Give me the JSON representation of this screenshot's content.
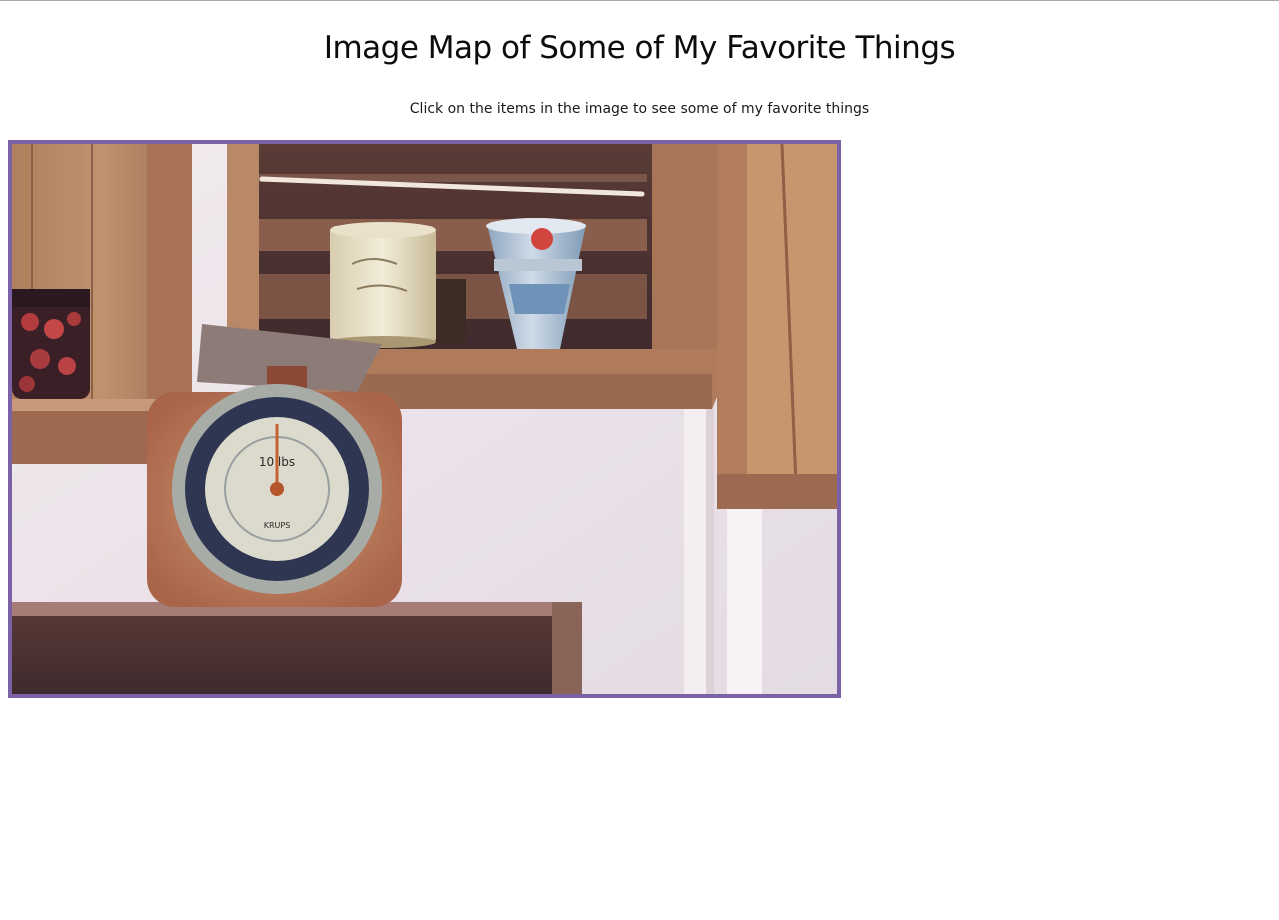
{
  "page": {
    "title": "Image Map of Some of My Favorite Things",
    "instructions": "Click on the items in the image to see some of my favorite things"
  },
  "image": {
    "frame_color": "#7b62a6",
    "scale_brand": "KRUPS",
    "scale_capacity": "10 lbs",
    "hotspots": [
      {
        "name": "jar-of-cherries"
      },
      {
        "name": "kitchen-scale"
      },
      {
        "name": "white-tin-can"
      },
      {
        "name": "blue-paper-cup"
      }
    ]
  }
}
